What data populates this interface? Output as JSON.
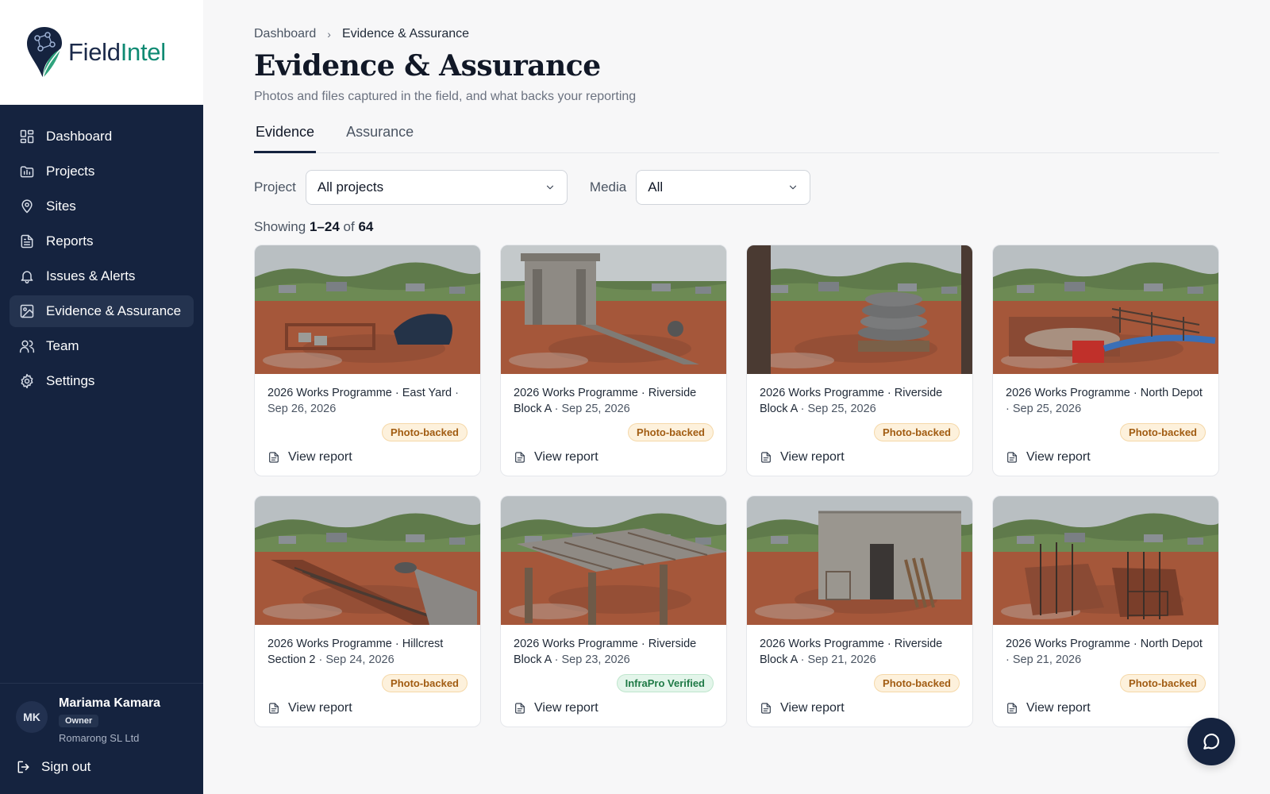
{
  "brand": {
    "name_part1": "Field",
    "name_part2": "Intel",
    "accent": "#0f8a73",
    "navy": "#15233f"
  },
  "sidebar": {
    "items": [
      {
        "label": "Dashboard",
        "icon": "dashboard-icon"
      },
      {
        "label": "Projects",
        "icon": "projects-icon"
      },
      {
        "label": "Sites",
        "icon": "map-pin-icon"
      },
      {
        "label": "Reports",
        "icon": "report-icon"
      },
      {
        "label": "Issues & Alerts",
        "icon": "bell-icon"
      },
      {
        "label": "Evidence & Assurance",
        "icon": "image-icon",
        "active": true
      },
      {
        "label": "Team",
        "icon": "team-icon"
      },
      {
        "label": "Settings",
        "icon": "gear-icon"
      }
    ],
    "user": {
      "initials": "MK",
      "name": "Mariama Kamara",
      "role": "Owner",
      "org": "Romarong SL Ltd"
    },
    "sign_out": "Sign out"
  },
  "breadcrumb": {
    "parent": "Dashboard",
    "current": "Evidence & Assurance"
  },
  "page": {
    "title": "Evidence & Assurance",
    "subtitle": "Photos and files captured in the field, and what backs your reporting"
  },
  "tabs": [
    {
      "label": "Evidence",
      "active": true
    },
    {
      "label": "Assurance",
      "active": false
    }
  ],
  "filters": {
    "project_label": "Project",
    "project_value": "All projects",
    "media_label": "Media",
    "media_value": "All"
  },
  "results": {
    "prefix": "Showing",
    "range": "1–24",
    "of": "of",
    "total": "64"
  },
  "cards": [
    {
      "title": "2026 Works Programme · East Yard",
      "sep": " · ",
      "date": "Sep 26, 2026",
      "badge": "Photo-backed",
      "badge_type": "photo",
      "action": "View report",
      "scene": "yard"
    },
    {
      "title": "2026 Works Programme · Riverside Block A",
      "sep": " · ",
      "date": "Sep 25, 2026",
      "badge": "Photo-backed",
      "badge_type": "photo",
      "action": "View report",
      "scene": "frame"
    },
    {
      "title": "2026 Works Programme · Riverside Block A",
      "sep": " · ",
      "date": "Sep 25, 2026",
      "badge": "Photo-backed",
      "badge_type": "photo",
      "action": "View report",
      "scene": "bags"
    },
    {
      "title": "2026 Works Programme · North Depot",
      "sep": " · ",
      "date": "Sep 25, 2026",
      "badge": "Photo-backed",
      "badge_type": "photo",
      "action": "View report",
      "scene": "pump"
    },
    {
      "title": "2026 Works Programme · Hillcrest Section 2",
      "sep": " · ",
      "date": "Sep 24, 2026",
      "badge": "Photo-backed",
      "badge_type": "photo",
      "action": "View report",
      "scene": "trench"
    },
    {
      "title": "2026 Works Programme · Riverside Block A",
      "sep": " · ",
      "date": "Sep 23, 2026",
      "badge": "InfraPro Verified",
      "badge_type": "verified",
      "action": "View report",
      "scene": "roof"
    },
    {
      "title": "2026 Works Programme · Riverside Block A",
      "sep": " · ",
      "date": "Sep 21, 2026",
      "badge": "Photo-backed",
      "badge_type": "photo",
      "action": "View report",
      "scene": "walls"
    },
    {
      "title": "2026 Works Programme · North Depot",
      "sep": " · ",
      "date": "Sep 21, 2026",
      "badge": "Photo-backed",
      "badge_type": "photo",
      "action": "View report",
      "scene": "rebar"
    }
  ]
}
